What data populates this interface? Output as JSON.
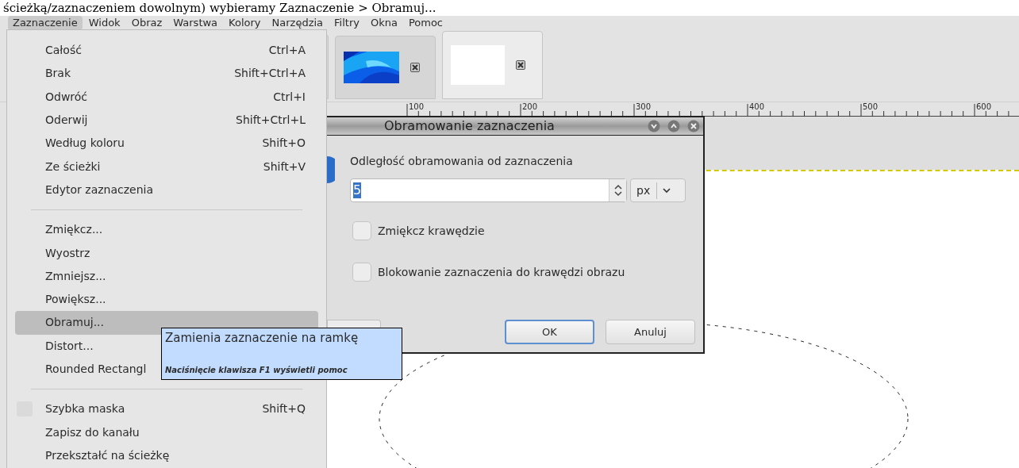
{
  "caption": "ścieżką/zaznaczeniem dowolnym) wybieramy Zaznaczenie > Obramuj...",
  "menubar": [
    {
      "label": "Zaznaczenie",
      "selected": true
    },
    {
      "label": "Widok",
      "selected": false
    },
    {
      "label": "Obraz",
      "selected": false
    },
    {
      "label": "Warstwa",
      "selected": false
    },
    {
      "label": "Kolory",
      "selected": false
    },
    {
      "label": "Narzędzia",
      "selected": false
    },
    {
      "label": "Filtry",
      "selected": false
    },
    {
      "label": "Okna",
      "selected": false
    },
    {
      "label": "Pomoc",
      "selected": false
    }
  ],
  "image_tabs": [
    {
      "kind": "picture",
      "selected": false
    },
    {
      "kind": "blank",
      "selected": true
    }
  ],
  "ruler": {
    "labels": [
      "100",
      "200",
      "300",
      "400",
      "500",
      "600"
    ]
  },
  "menu": {
    "items": [
      {
        "kind": "item",
        "label": "Całość",
        "shortcut": "Ctrl+A",
        "selected": false
      },
      {
        "kind": "item",
        "label": "Brak",
        "shortcut": "Shift+Ctrl+A",
        "selected": false
      },
      {
        "kind": "item",
        "label": "Odwróć",
        "shortcut": "Ctrl+I",
        "selected": false
      },
      {
        "kind": "item",
        "label": "Oderwij",
        "shortcut": "Shift+Ctrl+L",
        "selected": false
      },
      {
        "kind": "item",
        "label": "Według koloru",
        "shortcut": "Shift+O",
        "selected": false
      },
      {
        "kind": "item",
        "label": "Ze ścieżki",
        "shortcut": "Shift+V",
        "selected": false
      },
      {
        "kind": "item",
        "label": "Edytor zaznaczenia",
        "selected": false
      },
      {
        "kind": "separator"
      },
      {
        "kind": "item",
        "label": "Zmiękcz...",
        "selected": false
      },
      {
        "kind": "item",
        "label": "Wyostrz",
        "selected": false
      },
      {
        "kind": "item",
        "label": "Zmniejsz...",
        "selected": false
      },
      {
        "kind": "item",
        "label": "Powiększ...",
        "selected": false
      },
      {
        "kind": "item",
        "label": "Obramuj...",
        "selected": true
      },
      {
        "kind": "item",
        "label": "Distort...",
        "selected": false
      },
      {
        "kind": "item",
        "label": "Rounded Rectangl",
        "selected": false
      },
      {
        "kind": "separator"
      },
      {
        "kind": "toggle",
        "label": "Szybka maska",
        "shortcut": "Shift+Q",
        "checked": false,
        "selected": false
      },
      {
        "kind": "item",
        "label": "Zapisz do kanału",
        "selected": false
      },
      {
        "kind": "item",
        "label": "Przekształć na ścieżkę",
        "selected": false
      }
    ]
  },
  "dialog": {
    "title": "Obramowanie zaznaczenia",
    "label": "Odległość obramowania od zaznaczenia",
    "value": "5",
    "unit": "px",
    "checkboxes": [
      {
        "label": "Zmiękcz krawędzie",
        "checked": false
      },
      {
        "label": "Blokowanie zaznaczenia do krawędzi obrazu",
        "checked": false
      }
    ],
    "buttons": [
      {
        "label": "OK",
        "default": true
      },
      {
        "label": "Anuluj",
        "default": false
      }
    ]
  },
  "tooltip": {
    "title": "Zamienia zaznaczenie na ramkę",
    "hint": "Naciśnięcie klawisza F1 wyświetli pomoc"
  }
}
